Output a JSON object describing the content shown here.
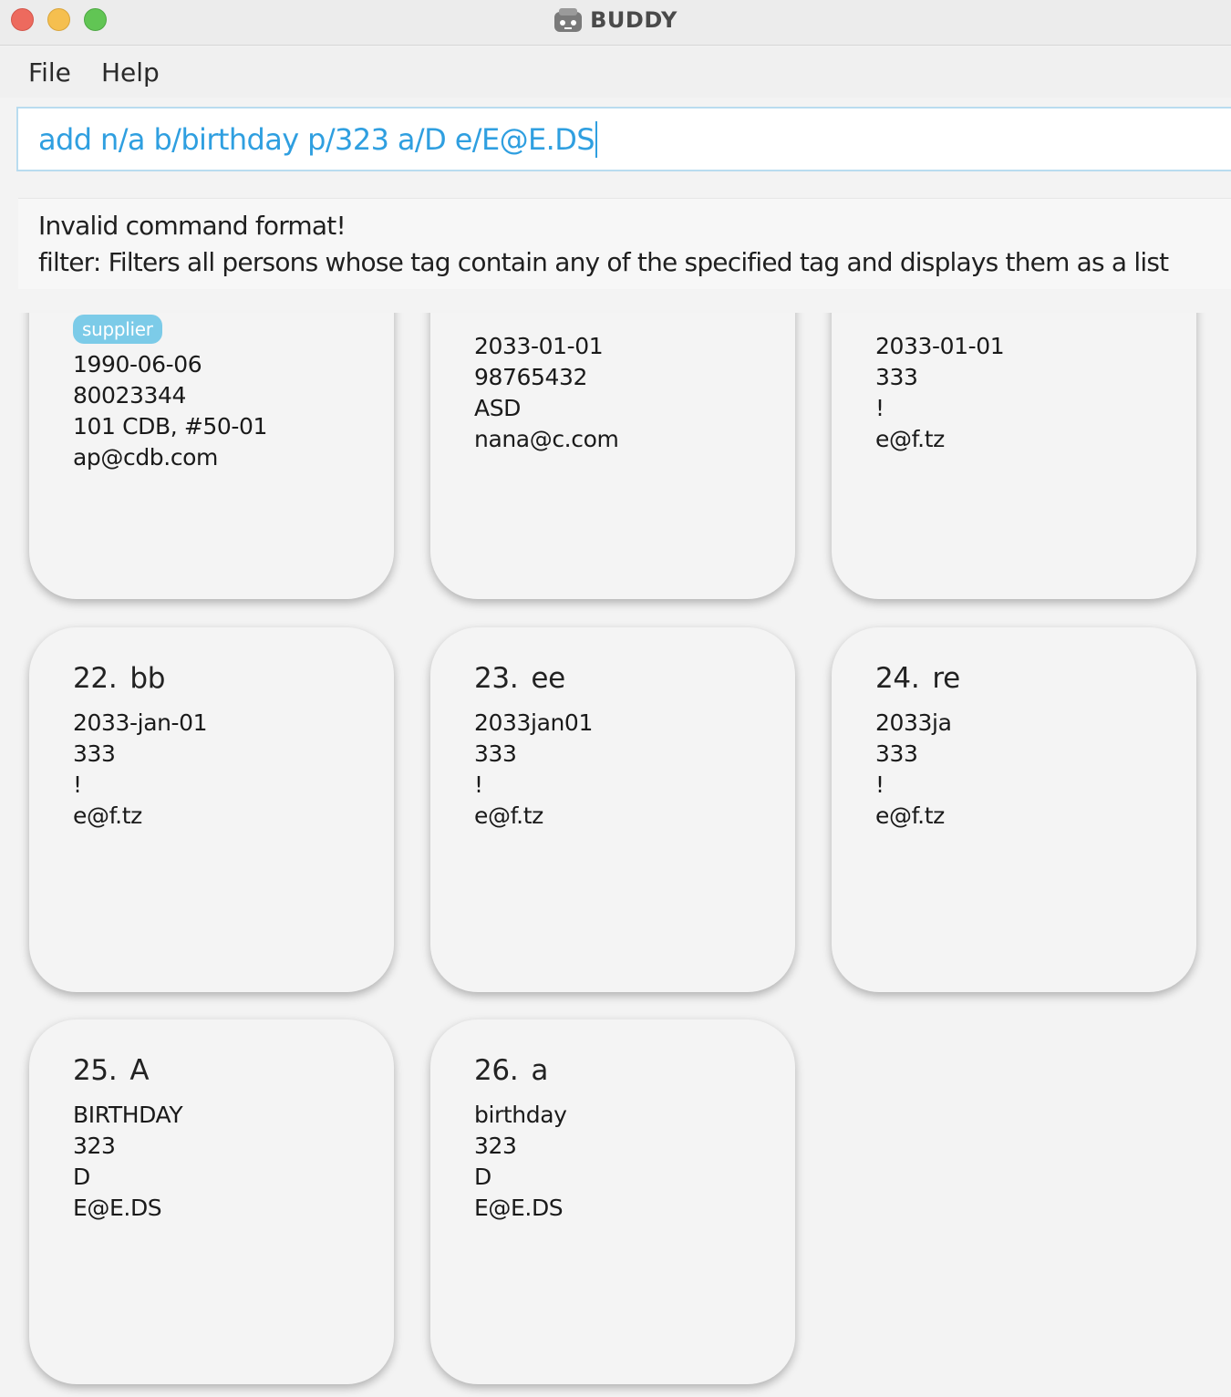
{
  "window": {
    "title": "BUDDY"
  },
  "menu": {
    "file": "File",
    "help": "Help"
  },
  "command": {
    "value": "add n/a b/birthday p/323 a/D e/E@E.DS"
  },
  "result": {
    "line1": "Invalid command format!",
    "line2": "filter: Filters all persons whose tag contain any of the specified tag and displays them as a list"
  },
  "cards": [
    {
      "tag": "supplier",
      "birthday": "1990-06-06",
      "phone": "80023344",
      "address": "101 CDB, #50-01",
      "email": "ap@cdb.com"
    },
    {
      "birthday": "2033-01-01",
      "phone": "98765432",
      "address": "ASD",
      "email": "nana@c.com"
    },
    {
      "birthday": "2033-01-01",
      "phone": "333",
      "address": "!",
      "email": "e@f.tz"
    },
    {
      "index": "22.",
      "name": "bb",
      "birthday": "2033-jan-01",
      "phone": "333",
      "address": "!",
      "email": "e@f.tz"
    },
    {
      "index": "23.",
      "name": "ee",
      "birthday": "2033jan01",
      "phone": "333",
      "address": "!",
      "email": "e@f.tz"
    },
    {
      "index": "24.",
      "name": "re",
      "birthday": "2033ja",
      "phone": "333",
      "address": "!",
      "email": "e@f.tz"
    },
    {
      "index": "25.",
      "name": "A",
      "birthday": "BIRTHDAY",
      "phone": "323",
      "address": "D",
      "email": "E@E.DS"
    },
    {
      "index": "26.",
      "name": "a",
      "birthday": "birthday",
      "phone": "323",
      "address": "D",
      "email": "E@E.DS"
    }
  ],
  "colors": {
    "accent": "#2f9fe0",
    "tag": "#7ccbe8",
    "card_bg": "#f4f4f4"
  }
}
